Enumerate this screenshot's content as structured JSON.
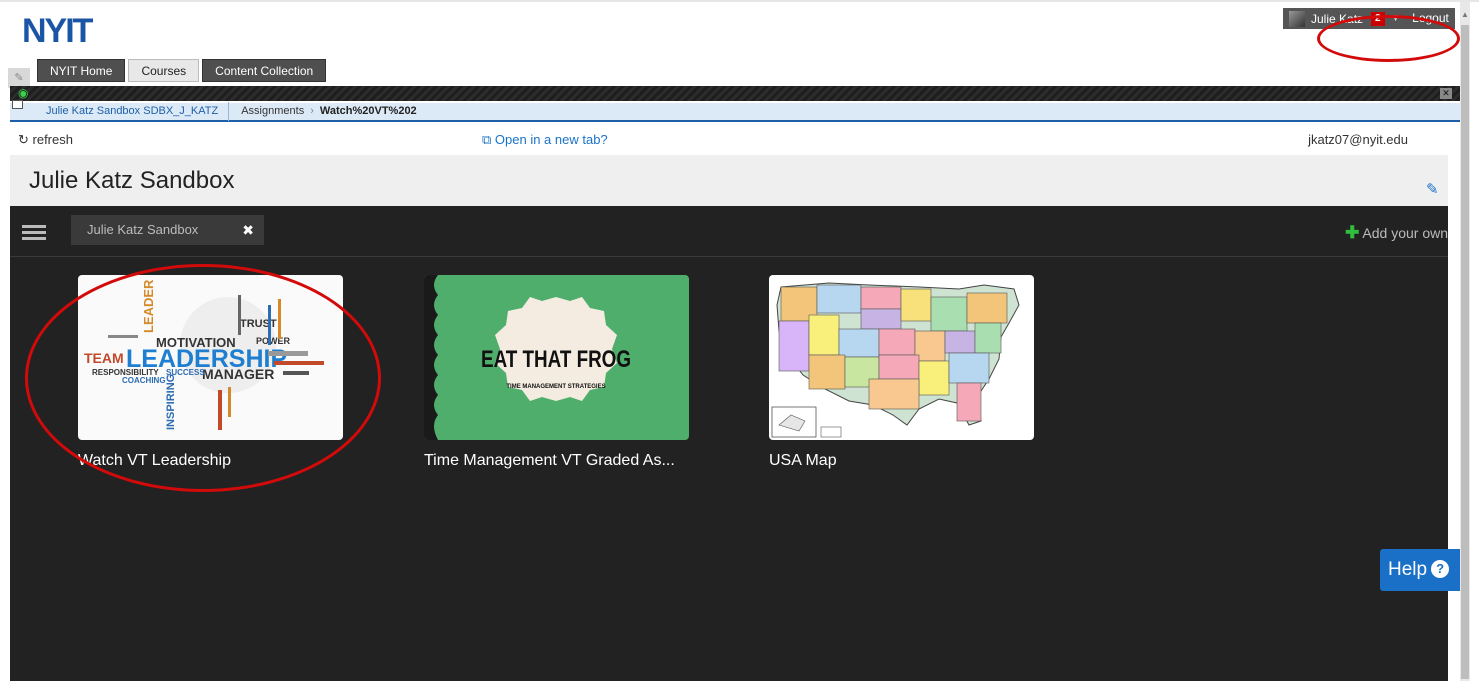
{
  "header": {
    "logo_text": "NYIT",
    "tabs": [
      {
        "label": "NYIT Home"
      },
      {
        "label": "Courses"
      },
      {
        "label": "Content Collection"
      }
    ],
    "user": {
      "name": "Julie Katz",
      "notification_count": "2"
    },
    "logout_label": "Logout"
  },
  "breadcrumb": {
    "course": "Julie Katz Sandbox SDBX_J_KATZ",
    "section": "Assignments",
    "current": "Watch%20VT%202"
  },
  "toolbar": {
    "refresh_label": "refresh",
    "newtab_label": "Open in a new tab?",
    "email": "jkatz07@nyit.edu"
  },
  "page": {
    "title": "Julie Katz Sandbox"
  },
  "panel": {
    "filter_chip": "Julie Katz Sandbox",
    "add_label": "Add your own",
    "cards": [
      {
        "title": "Watch VT Leadership",
        "thumb": "leadership word cloud"
      },
      {
        "title": "Time Management VT Graded As...",
        "thumb": "eat that frog"
      },
      {
        "title": "USA Map",
        "thumb": "us map"
      }
    ],
    "frog": {
      "headline": "EAT THAT FROG",
      "sub": "TIME MANAGEMENT STRATEGIES"
    },
    "leadership_words": {
      "main": "LEADERSHIP",
      "w1": "MOTIVATION",
      "w2": "TEAM",
      "w3": "MANAGER",
      "w4": "RESPONSIBILITY",
      "w5": "SUCCESS",
      "w6": "LEADER",
      "w7": "INSPIRING",
      "w8": "COACHING",
      "w9": "TRUST",
      "w10": "POWER"
    }
  },
  "help": {
    "label": "Help"
  },
  "colors": {
    "accent": "#1a6fc7",
    "logo": "#1b55a6",
    "annotation": "#d30a0a",
    "panel_bg": "#222222"
  }
}
